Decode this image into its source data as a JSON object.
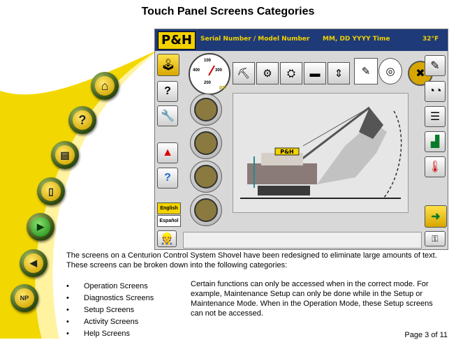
{
  "title": "Touch Panel Screens Categories",
  "panel": {
    "logo": "P&H",
    "header_fields": "Serial Number / Model Number",
    "header_datetime": "MM, DD YYYY Time",
    "header_temp": "32°F",
    "gauge_values": [
      "100",
      "200",
      "300",
      "400"
    ],
    "gauge_unit": "psi",
    "sign_label": "P&H",
    "language_buttons": [
      "English",
      "Español"
    ],
    "icons": {
      "left_column": [
        "joystick-icon",
        "help-question-icon",
        "wrench-icon",
        "warning-icon",
        "info-question-icon",
        "operator-icon"
      ],
      "center_round": [
        "hoist-icon",
        "crowd-icon",
        "swing-icon",
        "propel-icon"
      ],
      "top_row": [
        "bucket-icon",
        "gear-icon",
        "dipper-icon",
        "crawler-icon",
        "motion-icon",
        "pointer-icon",
        "target-icon",
        "tools-icon"
      ],
      "right_column": [
        "setup-icon",
        "gauges-icon",
        "list-icon",
        "chart-icon",
        "thermometer-icon",
        "next-arrow-icon",
        "key-icon"
      ]
    }
  },
  "nav_buttons": [
    "home-icon",
    "help-icon",
    "printer-icon",
    "exit-door-icon",
    "play-icon",
    "back-icon",
    "np-icon"
  ],
  "np_label": "NP",
  "description": "The screens on a Centurion Control System Shovel have been redesigned to eliminate large amounts of text. These screens can be broken down into the following categories:",
  "categories": [
    "Operation Screens",
    "Diagnostics Screens",
    "Setup Screens",
    "Activity Screens",
    "Help Screens"
  ],
  "note": "Certain functions can only be accessed when in the correct mode. For example, Maintenance Setup can only be done while in the Setup or Maintenance Mode. When in the Operation Mode, these Setup screens can not be accessed.",
  "page_number": "Page 3 of 11"
}
